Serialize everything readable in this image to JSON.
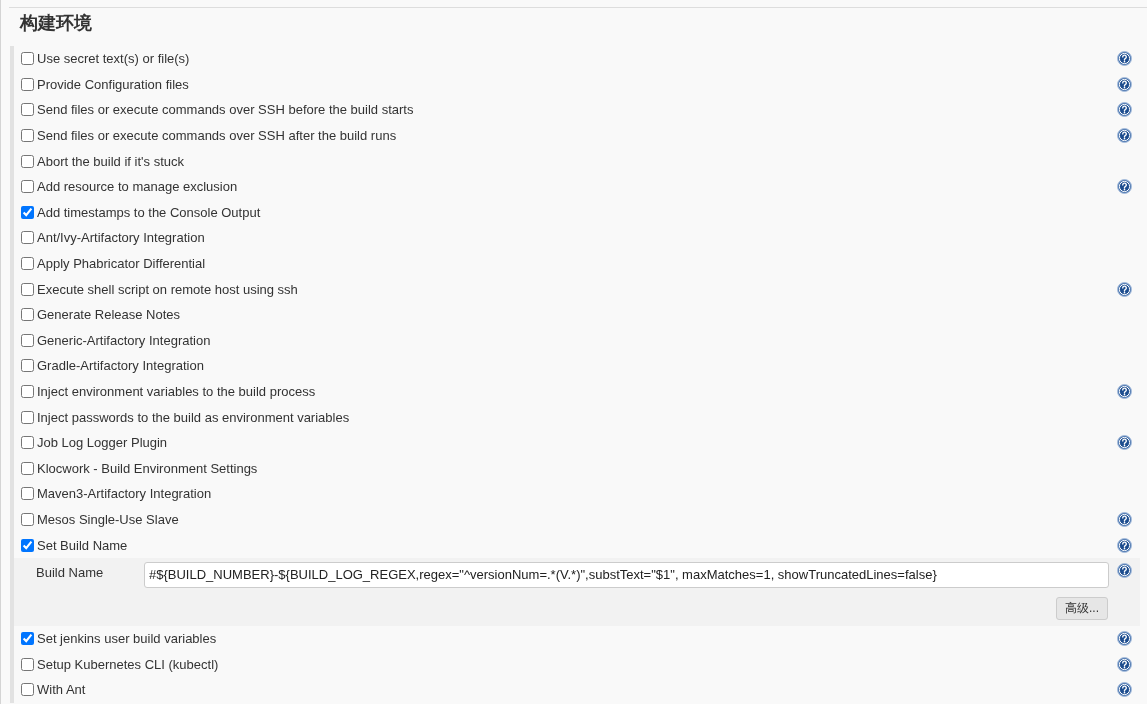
{
  "section": {
    "title": "构建环境"
  },
  "options": [
    {
      "label": "Use secret text(s) or file(s)",
      "checked": false,
      "help": true
    },
    {
      "label": "Provide Configuration files",
      "checked": false,
      "help": true
    },
    {
      "label": "Send files or execute commands over SSH before the build starts",
      "checked": false,
      "help": true
    },
    {
      "label": "Send files or execute commands over SSH after the build runs",
      "checked": false,
      "help": true
    },
    {
      "label": "Abort the build if it's stuck",
      "checked": false,
      "help": false
    },
    {
      "label": "Add resource to manage exclusion",
      "checked": false,
      "help": true
    },
    {
      "label": "Add timestamps to the Console Output",
      "checked": true,
      "help": false
    },
    {
      "label": "Ant/Ivy-Artifactory Integration",
      "checked": false,
      "help": false
    },
    {
      "label": "Apply Phabricator Differential",
      "checked": false,
      "help": false
    },
    {
      "label": "Execute shell script on remote host using ssh",
      "checked": false,
      "help": true
    },
    {
      "label": "Generate Release Notes",
      "checked": false,
      "help": false
    },
    {
      "label": "Generic-Artifactory Integration",
      "checked": false,
      "help": false
    },
    {
      "label": "Gradle-Artifactory Integration",
      "checked": false,
      "help": false
    },
    {
      "label": "Inject environment variables to the build process",
      "checked": false,
      "help": true
    },
    {
      "label": "Inject passwords to the build as environment variables",
      "checked": false,
      "help": false
    },
    {
      "label": "Job Log Logger Plugin",
      "checked": false,
      "help": true
    },
    {
      "label": "Klocwork - Build Environment Settings",
      "checked": false,
      "help": false
    },
    {
      "label": "Maven3-Artifactory Integration",
      "checked": false,
      "help": false
    },
    {
      "label": "Mesos Single-Use Slave",
      "checked": false,
      "help": true
    },
    {
      "label": "Set Build Name",
      "checked": true,
      "help": true,
      "settings": {
        "fields": [
          {
            "label": "Build Name",
            "value": "#${BUILD_NUMBER}-${BUILD_LOG_REGEX,regex=\"^versionNum=.*(V.*)\",substText=\"$1\", maxMatches=1, showTruncatedLines=false}",
            "help": true
          }
        ],
        "advanced_button": "高级..."
      }
    },
    {
      "label": "Set jenkins user build variables",
      "checked": true,
      "help": true
    },
    {
      "label": "Setup Kubernetes CLI (kubectl)",
      "checked": false,
      "help": true
    },
    {
      "label": "With Ant",
      "checked": false,
      "help": true
    }
  ]
}
